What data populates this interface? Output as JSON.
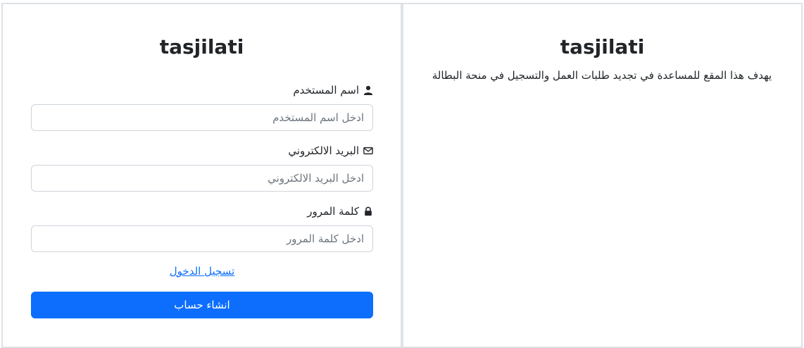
{
  "left_panel": {
    "title": "tasjilati",
    "username": {
      "label": "اسم المستخدم",
      "icon": "user-icon",
      "placeholder": "ادخل اسم المستخدم",
      "value": ""
    },
    "email": {
      "label": "البريد الالكتروني",
      "icon": "envelope-icon",
      "placeholder": "ادخل البريد الالكتروني",
      "value": ""
    },
    "password": {
      "label": "كلمة المرور",
      "icon": "lock-icon",
      "placeholder": "ادخل كلمة المرور",
      "value": ""
    },
    "login_link": "تسجيل الدخول",
    "signup_button": "انشاء حساب"
  },
  "right_panel": {
    "title": "tasjilati",
    "description": "يهدف هذا المقع للمساعدة في تجديد طلبات العمل والتسجيل في منحة البطالة"
  },
  "colors": {
    "primary": "#0d6efd",
    "border": "#dee2e6",
    "text": "#212529",
    "placeholder": "#6c757d"
  }
}
